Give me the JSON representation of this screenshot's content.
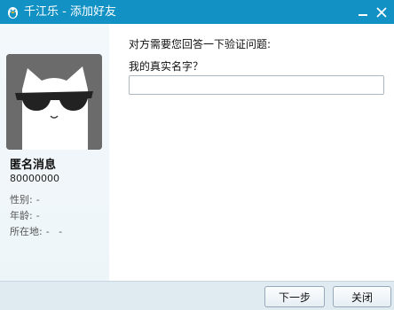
{
  "window": {
    "title": "千江乐 - 添加好友",
    "accent_color": "#1191c4",
    "controls": [
      "minimize-icon",
      "close-icon"
    ]
  },
  "profile": {
    "nickname": "匿名消息",
    "qq_number": "80000000",
    "fields": [
      {
        "label": "性别:",
        "value": "-"
      },
      {
        "label": "年龄:",
        "value": "-"
      },
      {
        "label": "所在地:",
        "value": "-   -"
      }
    ]
  },
  "verification": {
    "prompt": "对方需要您回答一下验证问题:",
    "question": "我的真实名字？",
    "answer_value": ""
  },
  "buttons": {
    "next_label": "下一步",
    "close_label": "关闭"
  }
}
